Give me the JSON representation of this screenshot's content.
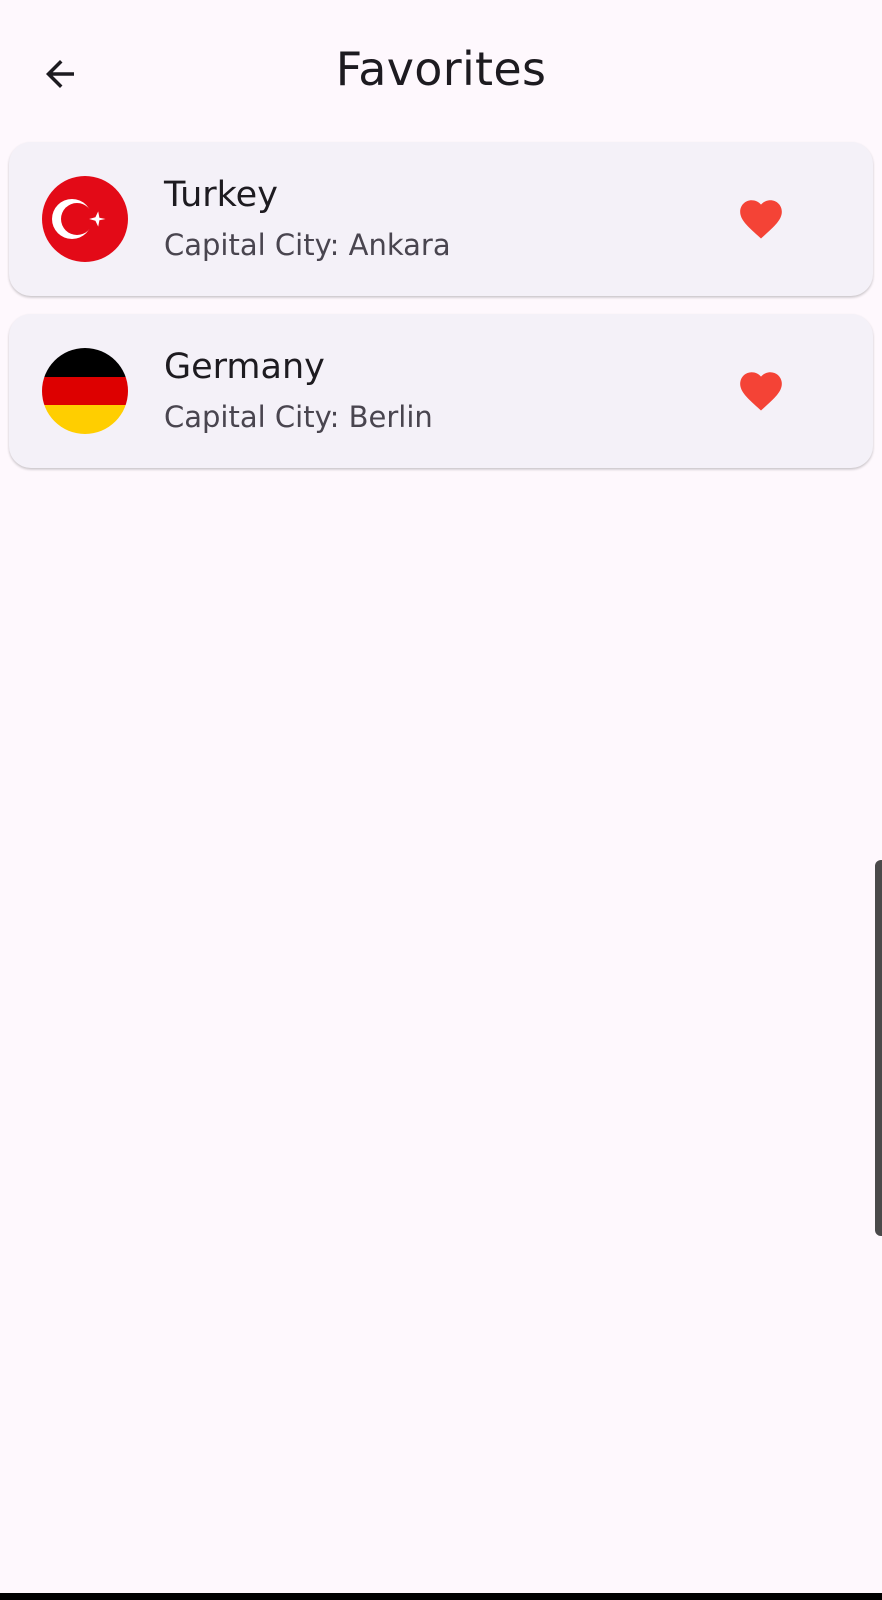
{
  "header": {
    "title": "Favorites",
    "back_icon": "arrow-back-icon"
  },
  "favorites": [
    {
      "country": "Turkey",
      "capital": "Capital City: Ankara",
      "flag_icon": "turkey-flag-icon",
      "favorite_icon": "heart-icon",
      "favorited": true
    },
    {
      "country": "Germany",
      "capital": "Capital City: Berlin",
      "flag_icon": "germany-flag-icon",
      "favorite_icon": "heart-icon",
      "favorited": true
    }
  ],
  "colors": {
    "background": "#fef8fd",
    "card": "#f4f1f8",
    "heart": "#f44336",
    "title_text": "#1d1b20",
    "subtitle_text": "#49454f"
  }
}
